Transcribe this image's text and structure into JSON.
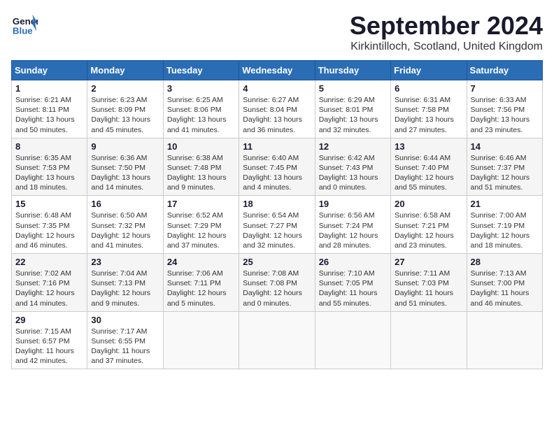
{
  "header": {
    "logo_line1": "General",
    "logo_line2": "Blue",
    "month_title": "September 2024",
    "subtitle": "Kirkintilloch, Scotland, United Kingdom"
  },
  "days_of_week": [
    "Sunday",
    "Monday",
    "Tuesday",
    "Wednesday",
    "Thursday",
    "Friday",
    "Saturday"
  ],
  "weeks": [
    [
      {
        "day": "1",
        "sunrise": "6:21 AM",
        "sunset": "8:11 PM",
        "daylight": "13 hours and 50 minutes."
      },
      {
        "day": "2",
        "sunrise": "6:23 AM",
        "sunset": "8:09 PM",
        "daylight": "13 hours and 45 minutes."
      },
      {
        "day": "3",
        "sunrise": "6:25 AM",
        "sunset": "8:06 PM",
        "daylight": "13 hours and 41 minutes."
      },
      {
        "day": "4",
        "sunrise": "6:27 AM",
        "sunset": "8:04 PM",
        "daylight": "13 hours and 36 minutes."
      },
      {
        "day": "5",
        "sunrise": "6:29 AM",
        "sunset": "8:01 PM",
        "daylight": "13 hours and 32 minutes."
      },
      {
        "day": "6",
        "sunrise": "6:31 AM",
        "sunset": "7:58 PM",
        "daylight": "13 hours and 27 minutes."
      },
      {
        "day": "7",
        "sunrise": "6:33 AM",
        "sunset": "7:56 PM",
        "daylight": "13 hours and 23 minutes."
      }
    ],
    [
      {
        "day": "8",
        "sunrise": "6:35 AM",
        "sunset": "7:53 PM",
        "daylight": "13 hours and 18 minutes."
      },
      {
        "day": "9",
        "sunrise": "6:36 AM",
        "sunset": "7:50 PM",
        "daylight": "13 hours and 14 minutes."
      },
      {
        "day": "10",
        "sunrise": "6:38 AM",
        "sunset": "7:48 PM",
        "daylight": "13 hours and 9 minutes."
      },
      {
        "day": "11",
        "sunrise": "6:40 AM",
        "sunset": "7:45 PM",
        "daylight": "13 hours and 4 minutes."
      },
      {
        "day": "12",
        "sunrise": "6:42 AM",
        "sunset": "7:43 PM",
        "daylight": "13 hours and 0 minutes."
      },
      {
        "day": "13",
        "sunrise": "6:44 AM",
        "sunset": "7:40 PM",
        "daylight": "12 hours and 55 minutes."
      },
      {
        "day": "14",
        "sunrise": "6:46 AM",
        "sunset": "7:37 PM",
        "daylight": "12 hours and 51 minutes."
      }
    ],
    [
      {
        "day": "15",
        "sunrise": "6:48 AM",
        "sunset": "7:35 PM",
        "daylight": "12 hours and 46 minutes."
      },
      {
        "day": "16",
        "sunrise": "6:50 AM",
        "sunset": "7:32 PM",
        "daylight": "12 hours and 41 minutes."
      },
      {
        "day": "17",
        "sunrise": "6:52 AM",
        "sunset": "7:29 PM",
        "daylight": "12 hours and 37 minutes."
      },
      {
        "day": "18",
        "sunrise": "6:54 AM",
        "sunset": "7:27 PM",
        "daylight": "12 hours and 32 minutes."
      },
      {
        "day": "19",
        "sunrise": "6:56 AM",
        "sunset": "7:24 PM",
        "daylight": "12 hours and 28 minutes."
      },
      {
        "day": "20",
        "sunrise": "6:58 AM",
        "sunset": "7:21 PM",
        "daylight": "12 hours and 23 minutes."
      },
      {
        "day": "21",
        "sunrise": "7:00 AM",
        "sunset": "7:19 PM",
        "daylight": "12 hours and 18 minutes."
      }
    ],
    [
      {
        "day": "22",
        "sunrise": "7:02 AM",
        "sunset": "7:16 PM",
        "daylight": "12 hours and 14 minutes."
      },
      {
        "day": "23",
        "sunrise": "7:04 AM",
        "sunset": "7:13 PM",
        "daylight": "12 hours and 9 minutes."
      },
      {
        "day": "24",
        "sunrise": "7:06 AM",
        "sunset": "7:11 PM",
        "daylight": "12 hours and 5 minutes."
      },
      {
        "day": "25",
        "sunrise": "7:08 AM",
        "sunset": "7:08 PM",
        "daylight": "12 hours and 0 minutes."
      },
      {
        "day": "26",
        "sunrise": "7:10 AM",
        "sunset": "7:05 PM",
        "daylight": "11 hours and 55 minutes."
      },
      {
        "day": "27",
        "sunrise": "7:11 AM",
        "sunset": "7:03 PM",
        "daylight": "11 hours and 51 minutes."
      },
      {
        "day": "28",
        "sunrise": "7:13 AM",
        "sunset": "7:00 PM",
        "daylight": "11 hours and 46 minutes."
      }
    ],
    [
      {
        "day": "29",
        "sunrise": "7:15 AM",
        "sunset": "6:57 PM",
        "daylight": "11 hours and 42 minutes."
      },
      {
        "day": "30",
        "sunrise": "7:17 AM",
        "sunset": "6:55 PM",
        "daylight": "11 hours and 37 minutes."
      },
      null,
      null,
      null,
      null,
      null
    ]
  ]
}
